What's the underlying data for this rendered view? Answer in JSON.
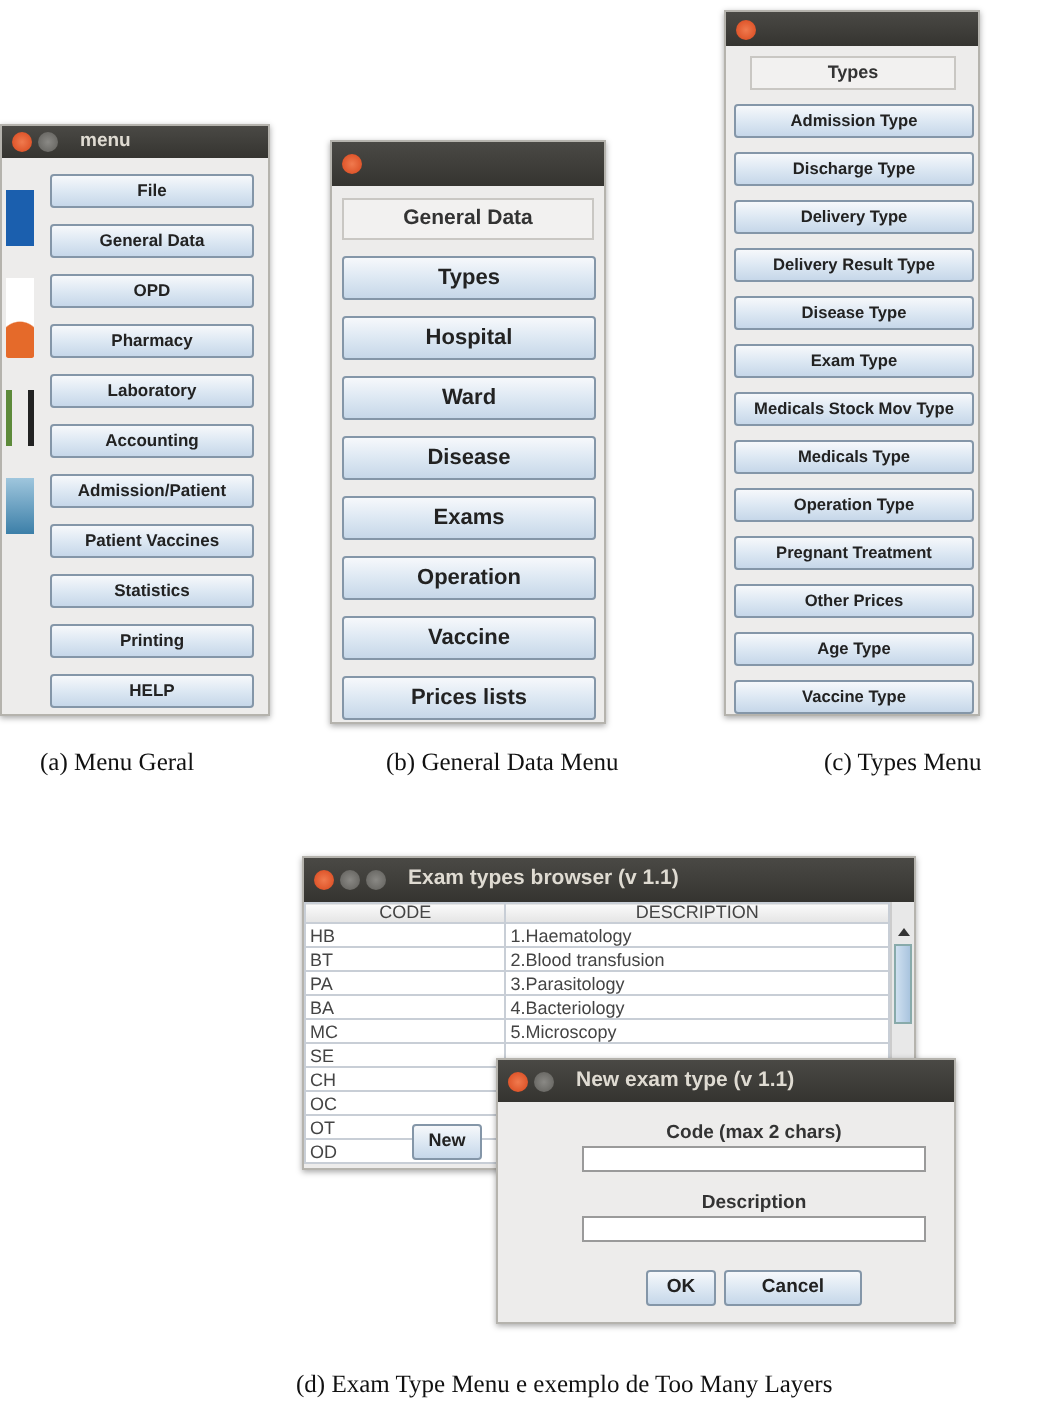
{
  "panels": [
    {
      "caption": "(a) Menu Geral",
      "window": {
        "title": "menu",
        "buttons": [
          "File",
          "General Data",
          "OPD",
          "Pharmacy",
          "Laboratory",
          "Accounting",
          "Admission/Patient",
          "Patient Vaccines",
          "Statistics",
          "Printing",
          "HELP"
        ]
      }
    },
    {
      "caption": "(b) General Data Menu",
      "window": {
        "heading": "General Data",
        "buttons": [
          "Types",
          "Hospital",
          "Ward",
          "Disease",
          "Exams",
          "Operation",
          "Vaccine",
          "Prices lists"
        ]
      }
    },
    {
      "caption": "(c) Types Menu",
      "window": {
        "heading": "Types",
        "buttons": [
          "Admission Type",
          "Discharge Type",
          "Delivery Type",
          "Delivery Result Type",
          "Disease Type",
          "Exam Type",
          "Medicals Stock Mov Type",
          "Medicals Type",
          "Operation Type",
          "Pregnant Treatment",
          "Other Prices",
          "Age Type",
          "Vaccine Type"
        ]
      }
    }
  ],
  "exam_browser": {
    "title": "Exam types browser (v 1.1)",
    "columns": [
      "CODE",
      "DESCRIPTION"
    ],
    "rows": [
      {
        "code": "HB",
        "description": "1.Haematology"
      },
      {
        "code": "BT",
        "description": "2.Blood transfusion"
      },
      {
        "code": "PA",
        "description": "3.Parasitology"
      },
      {
        "code": "BA",
        "description": "4.Bacteriology"
      },
      {
        "code": "MC",
        "description": "5.Microscopy"
      },
      {
        "code": "SE"
      },
      {
        "code": "CH"
      },
      {
        "code": "OC"
      },
      {
        "code": "OT"
      },
      {
        "code": "OD"
      }
    ],
    "buttons": [
      "New"
    ]
  },
  "new_dialog": {
    "title": "New exam type  (v 1.1)",
    "fields": [
      {
        "label": "Code (max 2 chars)"
      },
      {
        "label": "Description"
      }
    ],
    "buttons": [
      "OK",
      "Cancel"
    ]
  },
  "caption": "(d) Exam Type Menu e exemplo de Too Many Layers"
}
